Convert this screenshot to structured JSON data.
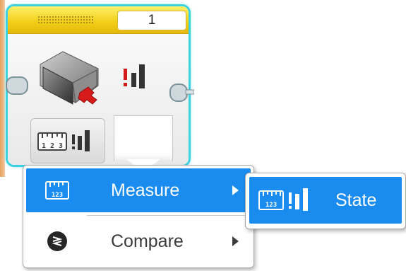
{
  "block": {
    "port_value": "1",
    "icons": {
      "sensor": "touch-sensor-icon",
      "state": "state-indicator-icon",
      "mode": "measure-state-mode-icon"
    }
  },
  "menu": {
    "items": [
      {
        "label": "Measure",
        "icon": "ruler-123-icon",
        "selected": true,
        "has_submenu": true
      },
      {
        "label": "Compare",
        "icon": "compare-icon",
        "selected": false,
        "has_submenu": true
      }
    ]
  },
  "submenu": {
    "items": [
      {
        "label": "State",
        "icon": "measure-state-icon",
        "selected": true
      }
    ]
  },
  "colors": {
    "selection": "#1a8cf0",
    "block_border": "#3ad1e0",
    "header": "#f2cd16",
    "sequence_beam": "#e7a15e"
  }
}
